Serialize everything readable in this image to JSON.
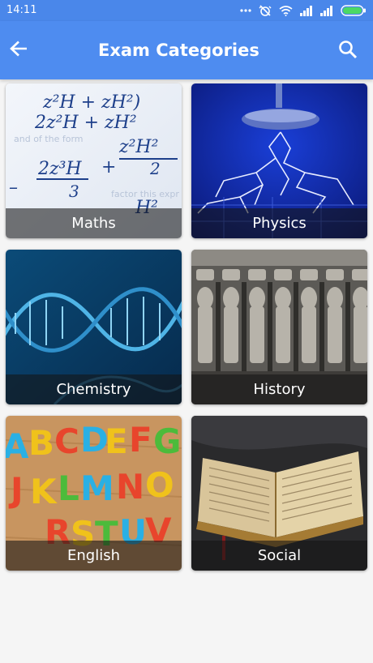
{
  "status": {
    "time": "14:11"
  },
  "header": {
    "title": "Exam Categories"
  },
  "icons": {
    "back": "arrow-back-icon",
    "search": "search-icon"
  },
  "colors": {
    "app_bar": "#4e8cf0",
    "status_bar": "#4a87ea",
    "background": "#f5f5f5"
  },
  "categories": [
    {
      "label": "Maths"
    },
    {
      "label": "Physics"
    },
    {
      "label": "Chemistry"
    },
    {
      "label": "History"
    },
    {
      "label": "English"
    },
    {
      "label": "Social"
    }
  ]
}
